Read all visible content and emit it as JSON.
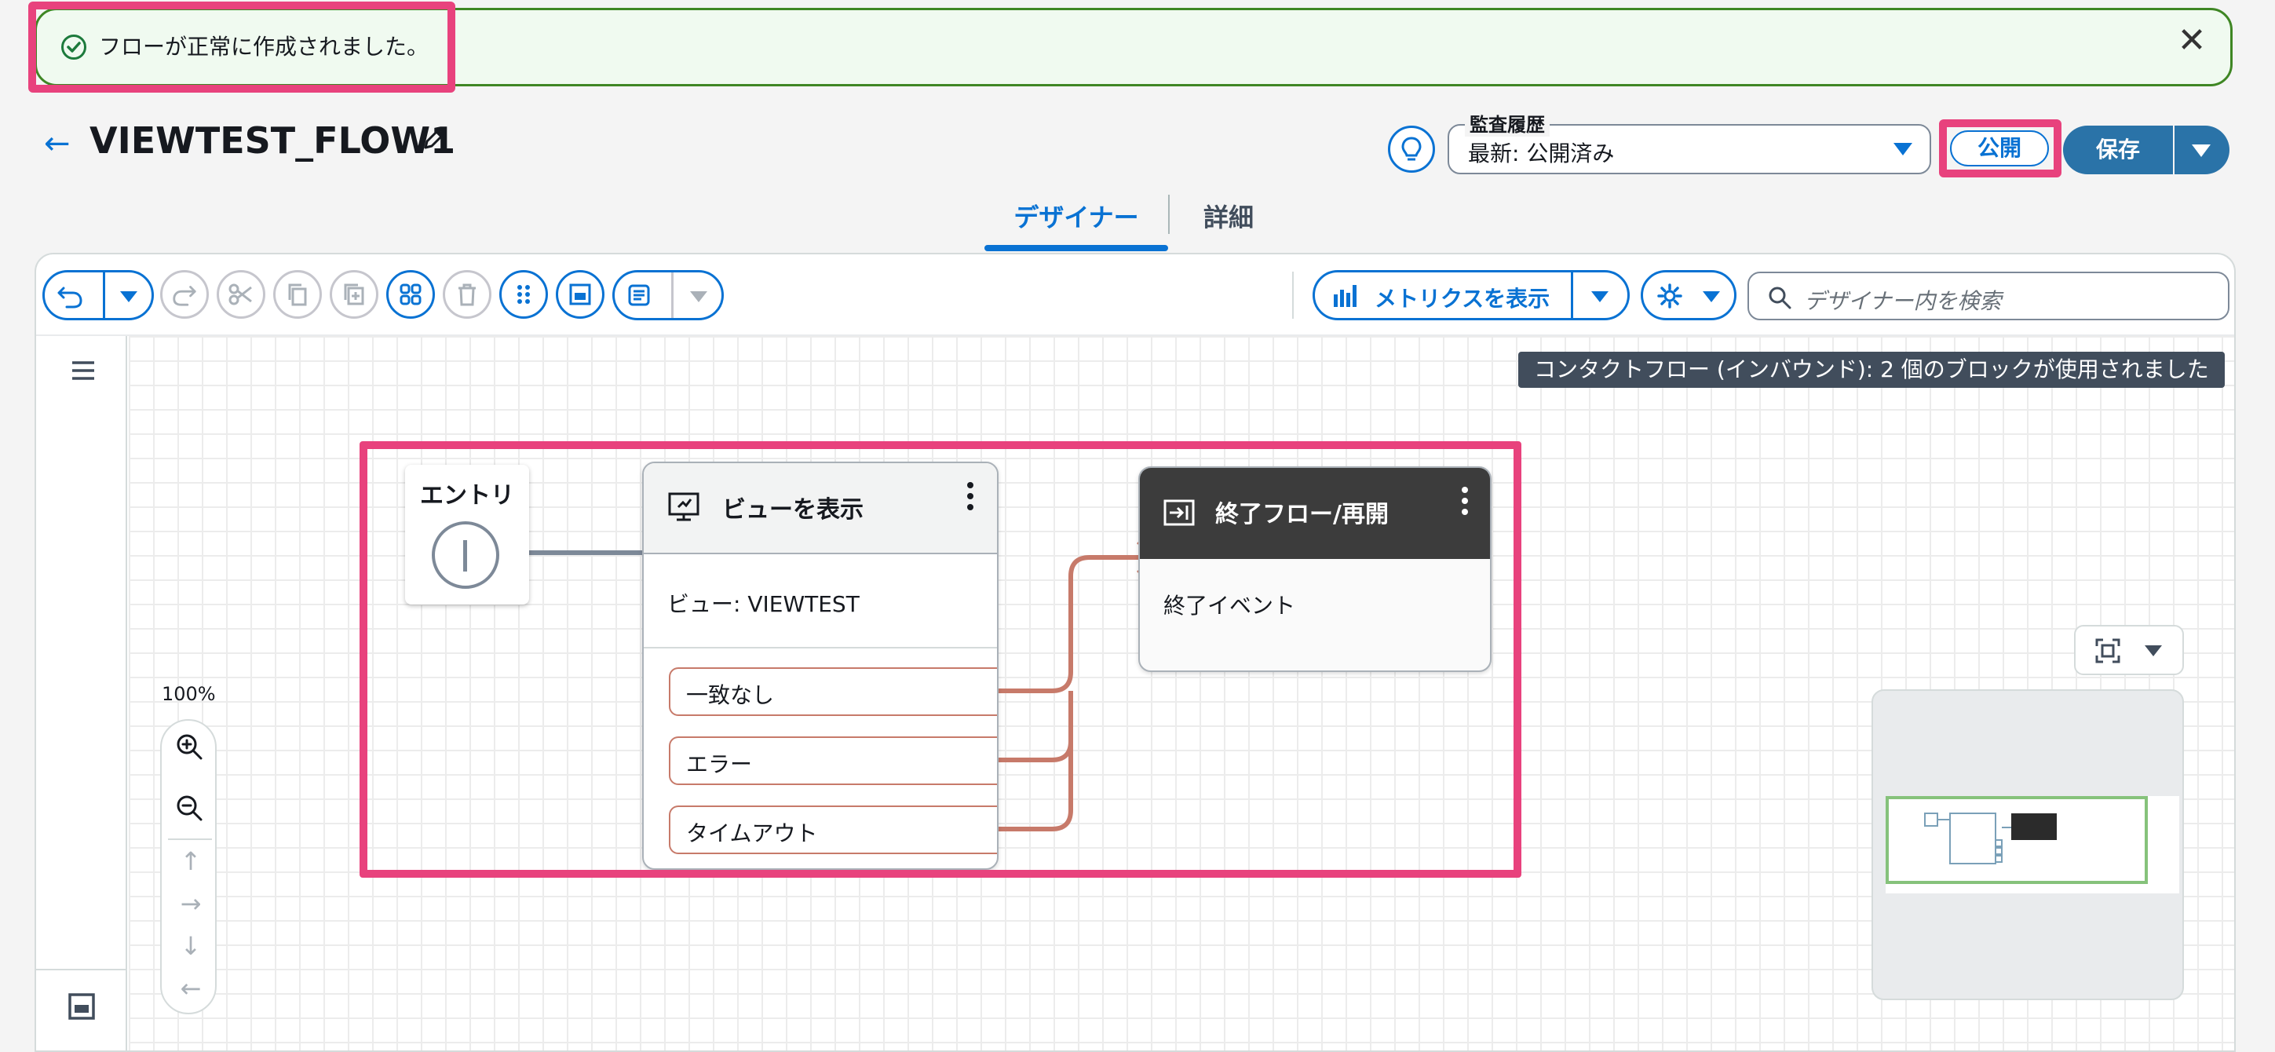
{
  "banner": {
    "message": "フローが正常に作成されました。",
    "close_glyph": "✕",
    "status_color": "#3f8624"
  },
  "header": {
    "back_glyph": "←",
    "flow_name": "VIEWTEST_FLOW1",
    "audit_label": "監査履歴",
    "audit_value": "最新: 公開済み",
    "publish_label": "公開",
    "save_label": "保存"
  },
  "tabs": [
    {
      "label": "デザイナー",
      "active": true
    },
    {
      "label": "詳細",
      "active": false
    }
  ],
  "toolbar": {
    "metrics_label": "メトリクスを表示",
    "search_placeholder": "デザイナー内を検索",
    "icons": [
      "undo-icon",
      "redo-icon",
      "cut-icon",
      "copy-icon",
      "paste-icon",
      "arrange-icon",
      "delete-icon",
      "drag-icon",
      "panel-icon",
      "notes-icon",
      "bar-chart-icon",
      "gear-icon",
      "search-icon"
    ]
  },
  "canvas": {
    "info_banner": "コンタクトフロー (インバウンド): 2 個のブロックが使用されました",
    "zoom_level": "100%",
    "entry": {
      "label": "エントリ"
    },
    "view_block": {
      "title": "ビューを表示",
      "body": "ビュー: VIEWTEST",
      "branches": [
        "一致なし",
        "エラー",
        "タイムアウト"
      ]
    },
    "end_block": {
      "title": "終了フロー/再開",
      "body": "終了イベント"
    }
  },
  "colors": {
    "accent": "#0972d3",
    "highlight": "#e8427d",
    "branch_line": "#c77a6a",
    "end_header": "#3c3c3c"
  }
}
